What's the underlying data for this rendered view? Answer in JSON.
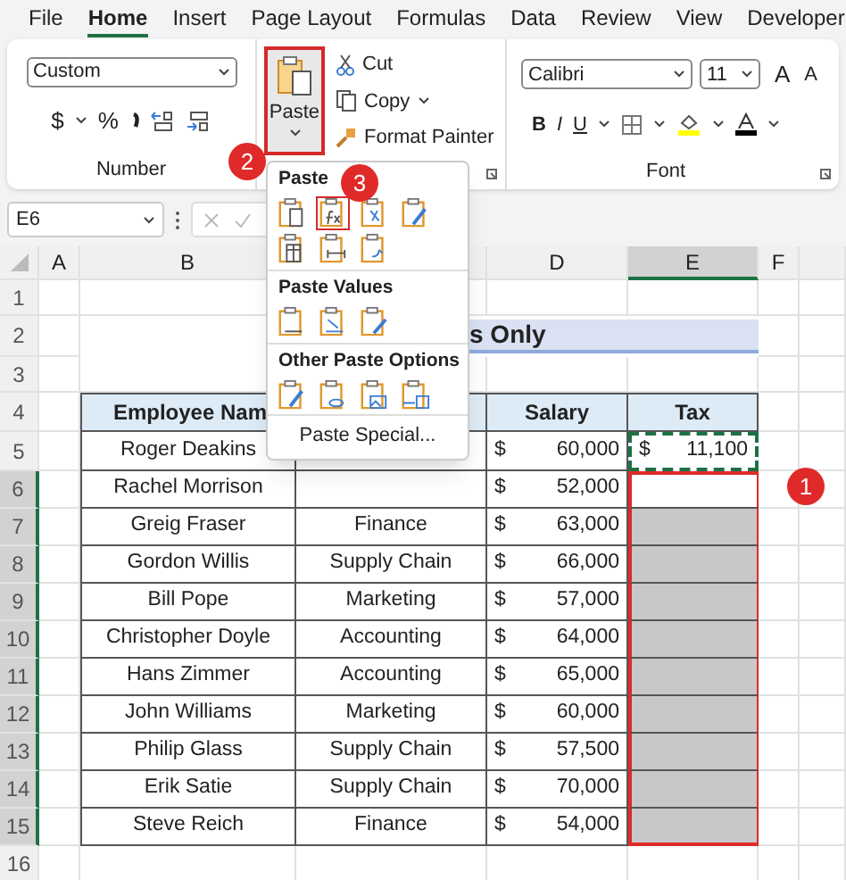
{
  "menu_tabs": [
    {
      "label": "File",
      "selected": false
    },
    {
      "label": "Home",
      "selected": true
    },
    {
      "label": "Insert",
      "selected": false
    },
    {
      "label": "Page Layout",
      "selected": false
    },
    {
      "label": "Formulas",
      "selected": false
    },
    {
      "label": "Data",
      "selected": false
    },
    {
      "label": "Review",
      "selected": false
    },
    {
      "label": "View",
      "selected": false
    },
    {
      "label": "Developer",
      "selected": false
    }
  ],
  "number_group": {
    "format": "Custom",
    "currency": "$",
    "percent": "%",
    "label": "Number"
  },
  "clipboard_group": {
    "paste": "Paste",
    "cut": "Cut",
    "copy": "Copy",
    "format_painter": "Format Painter"
  },
  "font_group": {
    "font": "Calibri",
    "size": "11",
    "bold": "B",
    "italic": "I",
    "underline": "U",
    "grow": "A",
    "shrink": "A",
    "label": "Font"
  },
  "name_box": "E6",
  "columns": [
    {
      "label": "A",
      "selected": false
    },
    {
      "label": "B",
      "selected": false
    },
    {
      "selected": false
    },
    {
      "label": "D",
      "selected": false
    },
    {
      "label": "E",
      "selected": true
    },
    {
      "label": "F",
      "selected": false
    }
  ],
  "title": "s Only",
  "headers": [
    "Employee Nam",
    "Salary",
    "Tax"
  ],
  "rows": [
    {
      "name": "Roger Deakins",
      "currency": "$",
      "salary": "60,000",
      "tax_currency": "$",
      "tax": "11,100",
      "copied": true,
      "selected": false
    },
    {
      "name": "Rachel Morrison",
      "currency": "$",
      "salary": "52,000",
      "copied": false,
      "selected": true
    },
    {
      "name": "Greig Fraser",
      "department": "Finance",
      "currency": "$",
      "salary": "63,000",
      "copied": false,
      "selected": true
    },
    {
      "name": "Gordon Willis",
      "department": "Supply Chain",
      "currency": "$",
      "salary": "66,000",
      "copied": false,
      "selected": true
    },
    {
      "name": "Bill Pope",
      "department": "Marketing",
      "currency": "$",
      "salary": "57,000",
      "copied": false,
      "selected": true
    },
    {
      "name": "Christopher Doyle",
      "department": "Accounting",
      "currency": "$",
      "salary": "64,000",
      "copied": false,
      "selected": true
    },
    {
      "name": "Hans Zimmer",
      "department": "Accounting",
      "currency": "$",
      "salary": "65,000",
      "copied": false,
      "selected": true
    },
    {
      "name": "John Williams",
      "department": "Marketing",
      "currency": "$",
      "salary": "60,000",
      "copied": false,
      "selected": true
    },
    {
      "name": "Philip Glass",
      "department": "Supply Chain",
      "currency": "$",
      "salary": "57,500",
      "copied": false,
      "selected": true
    },
    {
      "name": "Erik Satie",
      "department": "Supply Chain",
      "currency": "$",
      "salary": "70,000",
      "copied": false,
      "selected": true
    },
    {
      "name": "Steve Reich",
      "department": "Finance",
      "currency": "$",
      "salary": "54,000",
      "copied": false,
      "selected": true
    }
  ],
  "row_numbers": [
    "1",
    "2",
    "3",
    "4",
    "5",
    "6",
    "7",
    "8",
    "9",
    "10",
    "11",
    "12",
    "13",
    "14",
    "15",
    "16"
  ],
  "paste_menu": {
    "sections": [
      {
        "title": "Paste",
        "options": [
          {
            "kind": "plain",
            "selected": false
          },
          {
            "kind": "formula",
            "selected": true
          },
          {
            "kind": "formula-number",
            "selected": false
          },
          {
            "kind": "brush",
            "selected": false
          },
          {
            "kind": "grid",
            "selected": false
          },
          {
            "kind": "width",
            "selected": false
          },
          {
            "kind": "transpose",
            "selected": false
          }
        ]
      },
      {
        "title": "Paste Values",
        "options": [
          {
            "kind": "values",
            "selected": false
          },
          {
            "kind": "values-number",
            "selected": false
          },
          {
            "kind": "values-brush",
            "selected": false
          }
        ]
      },
      {
        "title": "Other Paste Options",
        "options": [
          {
            "kind": "format",
            "selected": false
          },
          {
            "kind": "link",
            "selected": false
          },
          {
            "kind": "picture",
            "selected": false
          },
          {
            "kind": "linked-picture",
            "selected": false
          }
        ]
      }
    ],
    "special": "Paste Special..."
  },
  "steps": [
    "1",
    "2",
    "3"
  ]
}
